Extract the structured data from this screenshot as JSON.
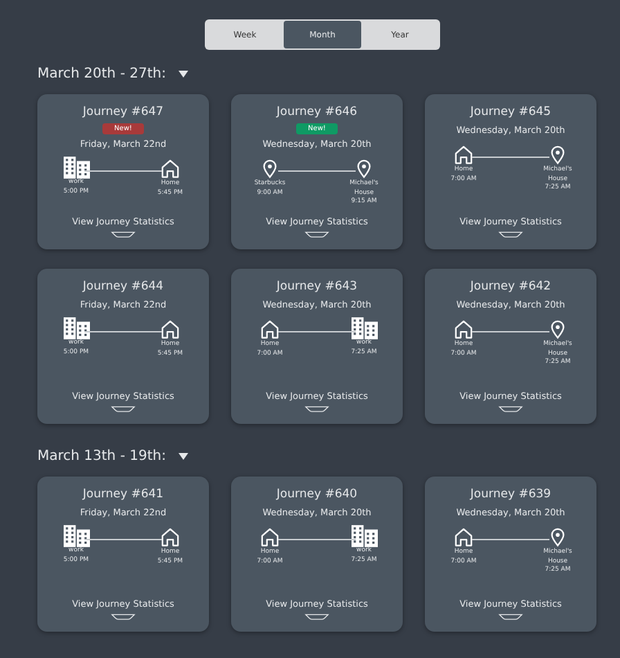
{
  "period_tabs": [
    {
      "label": "Week",
      "selected": false
    },
    {
      "label": "Month",
      "selected": true
    },
    {
      "label": "Year",
      "selected": false
    }
  ],
  "sections": [
    {
      "label": "March 20th - 27th:",
      "journeys": [
        {
          "title": "Journey #647",
          "badge": {
            "text": "New!",
            "color": "#a83a3a"
          },
          "date": "Friday, March 22nd",
          "from": {
            "kind": "building",
            "name": "work",
            "time": "5:00 PM"
          },
          "to": {
            "kind": "home",
            "name": "Home",
            "time": "5:45 PM"
          },
          "link": "View Journey Statistics"
        },
        {
          "title": "Journey #646",
          "badge": {
            "text": "New!",
            "color": "#0f9a64"
          },
          "date": "Wednesday, March 20th",
          "from": {
            "kind": "pin",
            "name": "Starbucks",
            "time": "9:00 AM"
          },
          "to": {
            "kind": "pin",
            "name": "Michael's House",
            "time": "9:15 AM"
          },
          "link": "View Journey Statistics"
        },
        {
          "title": "Journey #645",
          "date": "Wednesday, March 20th",
          "from": {
            "kind": "home",
            "name": "Home",
            "time": "7:00 AM"
          },
          "to": {
            "kind": "pin",
            "name": "Michael's House",
            "time": "7:25 AM"
          },
          "link": "View Journey Statistics"
        },
        {
          "title": "Journey #644",
          "date": "Friday, March 22nd",
          "from": {
            "kind": "building",
            "name": "work",
            "time": "5:00 PM"
          },
          "to": {
            "kind": "home",
            "name": "Home",
            "time": "5:45 PM"
          },
          "link": "View Journey Statistics"
        },
        {
          "title": "Journey #643",
          "date": "Wednesday, March 20th",
          "from": {
            "kind": "home",
            "name": "Home",
            "time": "7:00 AM"
          },
          "to": {
            "kind": "building",
            "name": "work",
            "time": "7:25 AM"
          },
          "link": "View Journey Statistics"
        },
        {
          "title": "Journey #642",
          "date": "Wednesday, March 20th",
          "from": {
            "kind": "home",
            "name": "Home",
            "time": "7:00 AM"
          },
          "to": {
            "kind": "pin",
            "name": "Michael's House",
            "time": "7:25 AM"
          },
          "link": "View Journey Statistics"
        }
      ]
    },
    {
      "label": "March 13th - 19th:",
      "journeys": [
        {
          "title": "Journey #641",
          "date": "Friday, March 22nd",
          "from": {
            "kind": "building",
            "name": "work",
            "time": "5:00 PM"
          },
          "to": {
            "kind": "home",
            "name": "Home",
            "time": "5:45 PM"
          },
          "link": "View Journey Statistics"
        },
        {
          "title": "Journey #640",
          "date": "Wednesday, March 20th",
          "from": {
            "kind": "home",
            "name": "Home",
            "time": "7:00 AM"
          },
          "to": {
            "kind": "building",
            "name": "work",
            "time": "7:25 AM"
          },
          "link": "View Journey Statistics"
        },
        {
          "title": "Journey #639",
          "date": "Wednesday, March 20th",
          "from": {
            "kind": "home",
            "name": "Home",
            "time": "7:00 AM"
          },
          "to": {
            "kind": "pin",
            "name": "Michael's House",
            "time": "7:25 AM"
          },
          "link": "View Journey Statistics"
        }
      ]
    }
  ]
}
